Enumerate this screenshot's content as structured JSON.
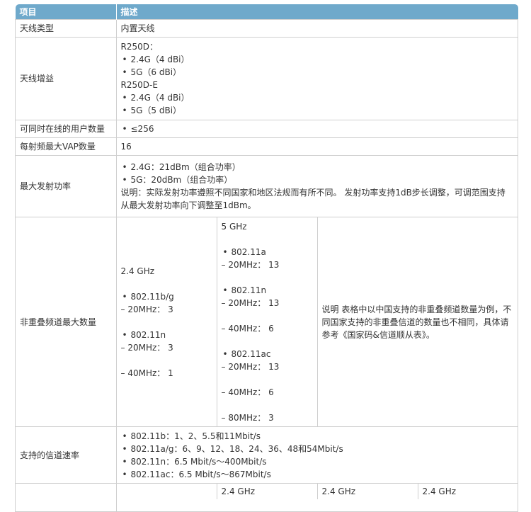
{
  "header": {
    "col1": "项目",
    "col2": "描述"
  },
  "rows": {
    "antenna_type": {
      "label": "天线类型",
      "value": "内置天线"
    },
    "antenna_gain": {
      "label": "天线增益",
      "groups": [
        {
          "title": "R250D：",
          "items": [
            "2.4G（4 dBi）",
            "5G（6 dBi）"
          ]
        },
        {
          "title": "R250D-E",
          "items": [
            "2.4G（4 dBi）",
            "5G（5 dBi）"
          ]
        }
      ]
    },
    "max_users": {
      "label": "可同时在线的用户数量",
      "items": [
        "≤256"
      ]
    },
    "max_vap": {
      "label": "每射频最大VAP数量",
      "value": "16"
    },
    "max_tx_power": {
      "label": "最大发射功率",
      "items": [
        "2.4G：21dBm（组合功率）",
        "5G：20dBm（组合功率）"
      ],
      "note": "说明：实际发射功率遵照不同国家和地区法规而有所不同。 发射功率支持1dB步长调整，可调范围支持从最大发射功率向下调整至1dBm。"
    },
    "channels": {
      "label": "非重叠频道最大数量",
      "band24": {
        "title": "2.4 GHz",
        "b_label": "802.11b/g",
        "b_20": "– 20MHz： 3",
        "n_label": "802.11n",
        "n_20": "– 20MHz： 3",
        "n_40": "– 40MHz： 1"
      },
      "band5": {
        "title": "5 GHz",
        "a_label": "802.11a",
        "a_20": "– 20MHz： 13",
        "n_label": "802.11n",
        "n_20": "– 20MHz： 13",
        "n_40": "– 40MHz： 6",
        "ac_label": "802.11ac",
        "ac_20": "– 20MHz： 13",
        "ac_40": "– 40MHz： 6",
        "ac_80": "– 80MHz： 3"
      },
      "note": "说明 表格中以中国支持的非重叠频道数量为例，不同国家支持的非重叠信道的数量也不相同，具体请参考《国家码&信道顺从表》。"
    },
    "rates": {
      "label": "支持的信道速率",
      "items": [
        "802.11b：1、2、5.5和11Mbit/s",
        "802.11a/g：6、9、12、18、24、36、48和54Mbit/s",
        "802.11n：6.5 Mbit/s～400Mbit/s",
        "802.11ac：6.5 Mbit/s～867Mbit/s"
      ]
    },
    "last": {
      "cells": [
        "2.4 GHz",
        "2.4 GHz",
        "2.4 GHz"
      ]
    }
  }
}
